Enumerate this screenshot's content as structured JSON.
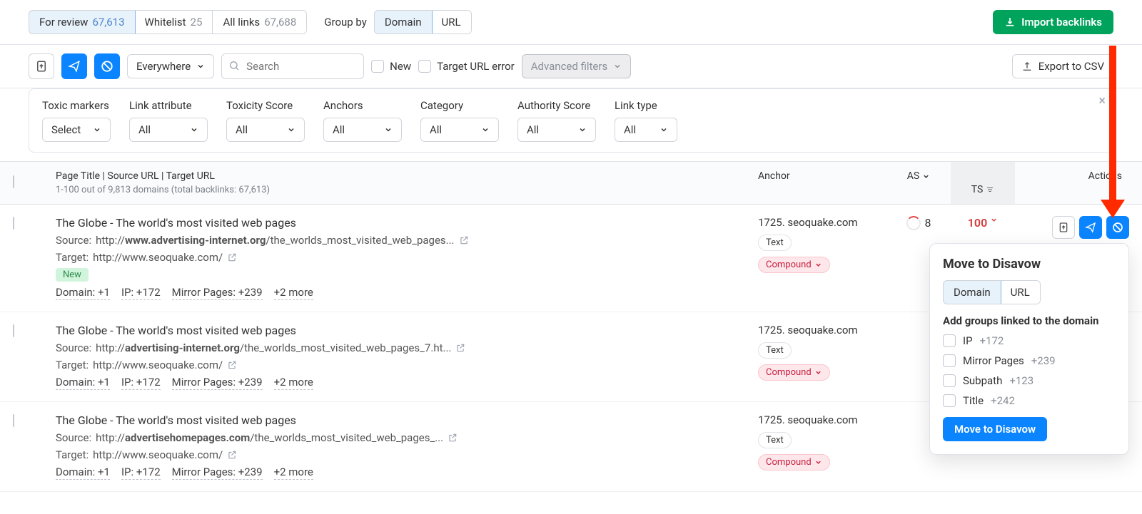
{
  "tabs": {
    "review": {
      "label": "For review",
      "count": "67,613"
    },
    "whitelist": {
      "label": "Whitelist",
      "count": "25"
    },
    "all": {
      "label": "All links",
      "count": "67,688"
    }
  },
  "group_by": {
    "label": "Group by",
    "options": [
      "Domain",
      "URL"
    ]
  },
  "import_btn": "Import backlinks",
  "toolbar": {
    "everywhere": "Everywhere",
    "search_placeholder": "Search",
    "new": "New",
    "target_err": "Target URL error",
    "adv_filters": "Advanced filters",
    "export": "Export to CSV"
  },
  "filters": {
    "toxic_markers": {
      "label": "Toxic markers",
      "value": "Select"
    },
    "link_attribute": {
      "label": "Link attribute",
      "value": "All"
    },
    "toxicity_score": {
      "label": "Toxicity Score",
      "value": "All"
    },
    "anchors": {
      "label": "Anchors",
      "value": "All"
    },
    "category": {
      "label": "Category",
      "value": "All"
    },
    "authority_score": {
      "label": "Authority Score",
      "value": "All"
    },
    "link_type": {
      "label": "Link type",
      "value": "All"
    }
  },
  "thead": {
    "main": "Page Title | Source URL | Target URL",
    "sub": "1-100 out of 9,813 domains (total backlinks: 67,613)",
    "anchor": "Anchor",
    "as": "AS",
    "ts": "TS",
    "actions": "Actions"
  },
  "rows": [
    {
      "title": "The Globe - The world's most visited web pages",
      "src_label": "Source:",
      "src_prefix": "http://",
      "src_bold": "www.advertising-internet.org",
      "src_rest": "/the_worlds_most_visited_web_pages...",
      "tgt_label": "Target:",
      "tgt": "http://www.seoquake.com/",
      "new": "New",
      "meta": [
        "Domain: +1",
        "IP: +172",
        "Mirror Pages: +239",
        "+2 more"
      ],
      "anchor": "1725. seoquake.com",
      "tag1": "Text",
      "tag2": "Compound",
      "as": "8",
      "ts": "100"
    },
    {
      "title": "The Globe - The world's most visited web pages",
      "src_label": "Source:",
      "src_prefix": "http://",
      "src_bold": "advertising-internet.org",
      "src_rest": "/the_worlds_most_visited_web_pages_7.ht...",
      "tgt_label": "Target:",
      "tgt": "http://www.seoquake.com/",
      "meta": [
        "Domain: +1",
        "IP: +172",
        "Mirror Pages: +239",
        "+2 more"
      ],
      "anchor": "1725. seoquake.com",
      "tag1": "Text",
      "tag2": "Compound"
    },
    {
      "title": "The Globe - The world's most visited web pages",
      "src_label": "Source:",
      "src_prefix": "http://",
      "src_bold": "advertisehomepages.com",
      "src_rest": "/the_worlds_most_visited_web_pages_...",
      "tgt_label": "Target:",
      "tgt": "http://www.seoquake.com/",
      "meta": [
        "Domain: +1",
        "IP: +172",
        "Mirror Pages: +239",
        "+2 more"
      ],
      "anchor": "1725. seoquake.com",
      "tag1": "Text",
      "tag2": "Compound"
    }
  ],
  "popup": {
    "title": "Move to Disavow",
    "tabs": [
      "Domain",
      "URL"
    ],
    "subhdr": "Add groups linked to the domain",
    "groups": [
      {
        "name": "IP",
        "plus": "+172"
      },
      {
        "name": "Mirror Pages",
        "plus": "+239"
      },
      {
        "name": "Subpath",
        "plus": "+123"
      },
      {
        "name": "Title",
        "plus": "+242"
      }
    ],
    "btn": "Move to Disavow"
  }
}
